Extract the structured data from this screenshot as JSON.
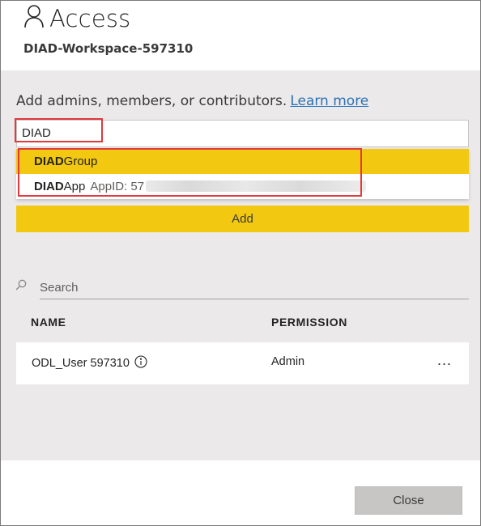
{
  "header": {
    "title": "Access",
    "workspace_name": "DIAD-Workspace-597310"
  },
  "add_section": {
    "label": "Add admins, members, or contributors.",
    "learn_more": "Learn more",
    "input_value": "DIAD",
    "suggestions": [
      {
        "match": "DIAD",
        "rest": "Group",
        "detail": ""
      },
      {
        "match": "DIAD",
        "rest": "App",
        "detail": "AppID: 57"
      }
    ],
    "add_button": "Add"
  },
  "search": {
    "placeholder": "Search"
  },
  "table": {
    "headers": {
      "name": "NAME",
      "permission": "PERMISSION"
    },
    "rows": [
      {
        "name": "ODL_User 597310",
        "permission": "Admin",
        "more": "..."
      }
    ]
  },
  "footer": {
    "close_button": "Close"
  },
  "colors": {
    "accent": "#f2c811",
    "highlight": "#e0393e",
    "link": "#2a73b5",
    "panel_bg": "#ece9eb"
  },
  "icons": [
    "person-icon",
    "search-icon",
    "info-icon"
  ]
}
